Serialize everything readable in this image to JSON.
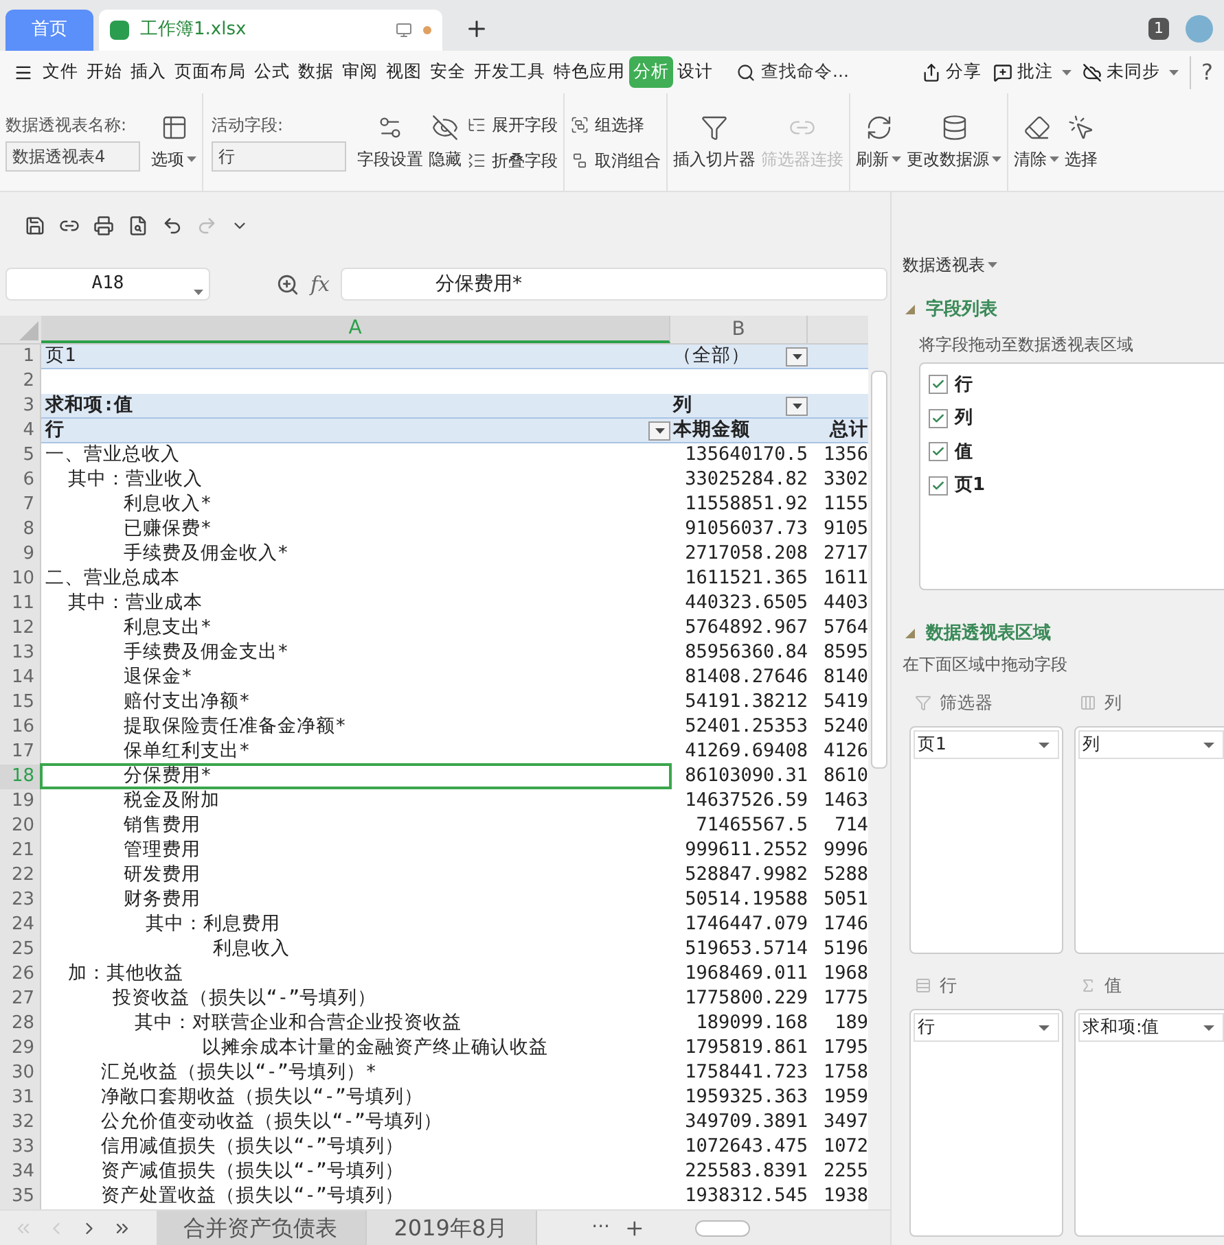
{
  "tabs": [
    {
      "label": "首页",
      "kind": "home",
      "selected": false
    },
    {
      "label": "工作簿1.xlsx",
      "kind": "file",
      "selected": true
    }
  ],
  "window_badge": "1",
  "menu": [
    {
      "label": "文件",
      "selected": false
    },
    {
      "label": "开始",
      "selected": false
    },
    {
      "label": "插入",
      "selected": false
    },
    {
      "label": "页面布局",
      "selected": false
    },
    {
      "label": "公式",
      "selected": false
    },
    {
      "label": "数据",
      "selected": false
    },
    {
      "label": "审阅",
      "selected": false
    },
    {
      "label": "视图",
      "selected": false
    },
    {
      "label": "安全",
      "selected": false
    },
    {
      "label": "开发工具",
      "selected": false
    },
    {
      "label": "特色应用",
      "selected": false
    },
    {
      "label": "分析",
      "selected": true
    },
    {
      "label": "设计",
      "selected": false
    }
  ],
  "search": {
    "placeholder": "查找命令..."
  },
  "menu_actions": [
    {
      "label": "分享",
      "dropdown": false
    },
    {
      "label": "批注",
      "dropdown": true
    },
    {
      "label": "未同步",
      "dropdown": true
    }
  ],
  "help": "?",
  "ribbon": {
    "name_label": "数据透视表名称:",
    "name_value": "数据透视表4",
    "active_label": "活动字段:",
    "active_value": "行",
    "groups": [
      [
        {
          "label": "选项",
          "kind": "large",
          "dropdown": true,
          "disabled": false
        }
      ],
      [
        {
          "label": "字段设置",
          "kind": "large",
          "dropdown": false,
          "disabled": false
        },
        {
          "label": "隐藏",
          "kind": "large",
          "dropdown": false,
          "disabled": false
        },
        {
          "label": "展开字段",
          "kind": "small",
          "dropdown": false,
          "disabled": false
        },
        {
          "label": "折叠字段",
          "kind": "small",
          "dropdown": false,
          "disabled": false
        }
      ],
      [
        {
          "label": "组选择",
          "kind": "small",
          "dropdown": false,
          "disabled": false
        },
        {
          "label": "取消组合",
          "kind": "small",
          "dropdown": false,
          "disabled": false
        }
      ],
      [
        {
          "label": "插入切片器",
          "kind": "large",
          "dropdown": false,
          "disabled": false
        },
        {
          "label": "筛选器连接",
          "kind": "large",
          "dropdown": false,
          "disabled": true
        }
      ],
      [
        {
          "label": "刷新",
          "kind": "large",
          "dropdown": true,
          "disabled": false
        },
        {
          "label": "更改数据源",
          "kind": "large",
          "dropdown": true,
          "disabled": false
        }
      ],
      [
        {
          "label": "清除",
          "kind": "large",
          "dropdown": true,
          "disabled": false
        },
        {
          "label": "选择",
          "kind": "large",
          "dropdown": false,
          "disabled": false
        }
      ]
    ]
  },
  "formula_bar": {
    "name_box": "A18",
    "fx": "fx",
    "value": "分保费用*"
  },
  "columns": [
    {
      "label": "A",
      "selected": true
    },
    {
      "label": "B",
      "selected": false
    }
  ],
  "rows": [
    {
      "number": "1",
      "kind": "page",
      "selected": false,
      "a": "页1",
      "b": "（全部）"
    },
    {
      "number": "2",
      "kind": "blank",
      "selected": false
    },
    {
      "number": "3",
      "kind": "value-header",
      "selected": false,
      "a": "求和项:值",
      "b": "列"
    },
    {
      "number": "4",
      "kind": "row-header",
      "selected": false,
      "a": "行",
      "b": "本期金额",
      "c": "总计"
    },
    {
      "number": "5",
      "kind": "data",
      "selected": false,
      "a": "一、营业总收入",
      "b": "135640170.5",
      "c": "1356"
    },
    {
      "number": "6",
      "kind": "data",
      "selected": false,
      "a": "  其中：营业收入",
      "b": "33025284.82",
      "c": "3302"
    },
    {
      "number": "7",
      "kind": "data",
      "selected": false,
      "a": "       利息收入*",
      "b": "11558851.92",
      "c": "1155"
    },
    {
      "number": "8",
      "kind": "data",
      "selected": false,
      "a": "       已赚保费*",
      "b": "91056037.73",
      "c": "9105"
    },
    {
      "number": "9",
      "kind": "data",
      "selected": false,
      "a": "       手续费及佣金收入*",
      "b": "2717058.208",
      "c": "2717"
    },
    {
      "number": "10",
      "kind": "data",
      "selected": false,
      "a": "二、营业总成本",
      "b": "1611521.365",
      "c": "1611"
    },
    {
      "number": "11",
      "kind": "data",
      "selected": false,
      "a": "  其中：营业成本",
      "b": "440323.6505",
      "c": "4403"
    },
    {
      "number": "12",
      "kind": "data",
      "selected": false,
      "a": "       利息支出*",
      "b": "5764892.967",
      "c": "5764"
    },
    {
      "number": "13",
      "kind": "data",
      "selected": false,
      "a": "       手续费及佣金支出*",
      "b": "85956360.84",
      "c": "8595"
    },
    {
      "number": "14",
      "kind": "data",
      "selected": false,
      "a": "       退保金*",
      "b": "81408.27646",
      "c": "8140"
    },
    {
      "number": "15",
      "kind": "data",
      "selected": false,
      "a": "       赔付支出净额*",
      "b": "54191.38212",
      "c": "5419"
    },
    {
      "number": "16",
      "kind": "data",
      "selected": false,
      "a": "       提取保险责任准备金净额*",
      "b": "52401.25353",
      "c": "5240"
    },
    {
      "number": "17",
      "kind": "data",
      "selected": false,
      "a": "       保单红利支出*",
      "b": "41269.69408",
      "c": "4126"
    },
    {
      "number": "18",
      "kind": "data",
      "selected": true,
      "a": "       分保费用*",
      "b": "86103090.31",
      "c": "8610"
    },
    {
      "number": "19",
      "kind": "data",
      "selected": false,
      "a": "       税金及附加",
      "b": "14637526.59",
      "c": "1463"
    },
    {
      "number": "20",
      "kind": "data",
      "selected": false,
      "a": "       销售费用",
      "b": "71465567.5",
      "c": "714"
    },
    {
      "number": "21",
      "kind": "data",
      "selected": false,
      "a": "       管理费用",
      "b": "999611.2552",
      "c": "9996"
    },
    {
      "number": "22",
      "kind": "data",
      "selected": false,
      "a": "       研发费用",
      "b": "528847.9982",
      "c": "5288"
    },
    {
      "number": "23",
      "kind": "data",
      "selected": false,
      "a": "       财务费用",
      "b": "50514.19588",
      "c": "5051"
    },
    {
      "number": "24",
      "kind": "data",
      "selected": false,
      "a": "         其中：利息费用",
      "b": "1746447.079",
      "c": "1746"
    },
    {
      "number": "25",
      "kind": "data",
      "selected": false,
      "a": "               利息收入",
      "b": "519653.5714",
      "c": "5196"
    },
    {
      "number": "26",
      "kind": "data",
      "selected": false,
      "a": "  加：其他收益",
      "b": "1968469.011",
      "c": "1968"
    },
    {
      "number": "27",
      "kind": "data",
      "selected": false,
      "a": "      投资收益（损失以“-”号填列）",
      "b": "1775800.229",
      "c": "1775"
    },
    {
      "number": "28",
      "kind": "data",
      "selected": false,
      "a": "        其中：对联营企业和合营企业投资收益",
      "b": "189099.168",
      "c": "189"
    },
    {
      "number": "29",
      "kind": "data",
      "selected": false,
      "a": "              以摊余成本计量的金融资产终止确认收益",
      "b": "1795819.861",
      "c": "1795"
    },
    {
      "number": "30",
      "kind": "data",
      "selected": false,
      "a": "     汇兑收益（损失以“-”号填列）*",
      "b": "1758441.723",
      "c": "1758"
    },
    {
      "number": "31",
      "kind": "data",
      "selected": false,
      "a": "     净敞口套期收益（损失以“-”号填列）",
      "b": "1959325.363",
      "c": "1959"
    },
    {
      "number": "32",
      "kind": "data",
      "selected": false,
      "a": "     公允价值变动收益（损失以“-”号填列）",
      "b": "349709.3891",
      "c": "3497"
    },
    {
      "number": "33",
      "kind": "data",
      "selected": false,
      "a": "     信用减值损失（损失以“-”号填列）",
      "b": "1072643.475",
      "c": "1072"
    },
    {
      "number": "34",
      "kind": "data",
      "selected": false,
      "a": "     资产减值损失（损失以“-”号填列）",
      "b": "225583.8391",
      "c": "2255"
    },
    {
      "number": "35",
      "kind": "data",
      "selected": false,
      "a": "     资产处置收益（损失以“-”号填列）",
      "b": "1938312.545",
      "c": "1938"
    }
  ],
  "sheet_tabs": [
    {
      "label": "合并资产负债表",
      "selected": true
    },
    {
      "label": "2019年8月",
      "selected": false
    }
  ],
  "sheet_more": "···",
  "panel": {
    "title": "数据透视表",
    "field_section": "字段列表",
    "field_hint": "将字段拖动至数据透视表区域",
    "fields": [
      {
        "label": "行",
        "checked": true
      },
      {
        "label": "列",
        "checked": true
      },
      {
        "label": "值",
        "checked": true
      },
      {
        "label": "页1",
        "checked": true
      }
    ],
    "area_section": "数据透视表区域",
    "area_hint": "在下面区域中拖动字段",
    "areas": [
      {
        "label": "筛选器",
        "kind": "filter",
        "items": [
          "页1"
        ]
      },
      {
        "label": "列",
        "kind": "columns",
        "items": [
          "列"
        ]
      },
      {
        "label": "行",
        "kind": "rows",
        "items": [
          "行"
        ]
      },
      {
        "label": "值",
        "kind": "values",
        "items": [
          "求和项:值"
        ]
      }
    ]
  }
}
